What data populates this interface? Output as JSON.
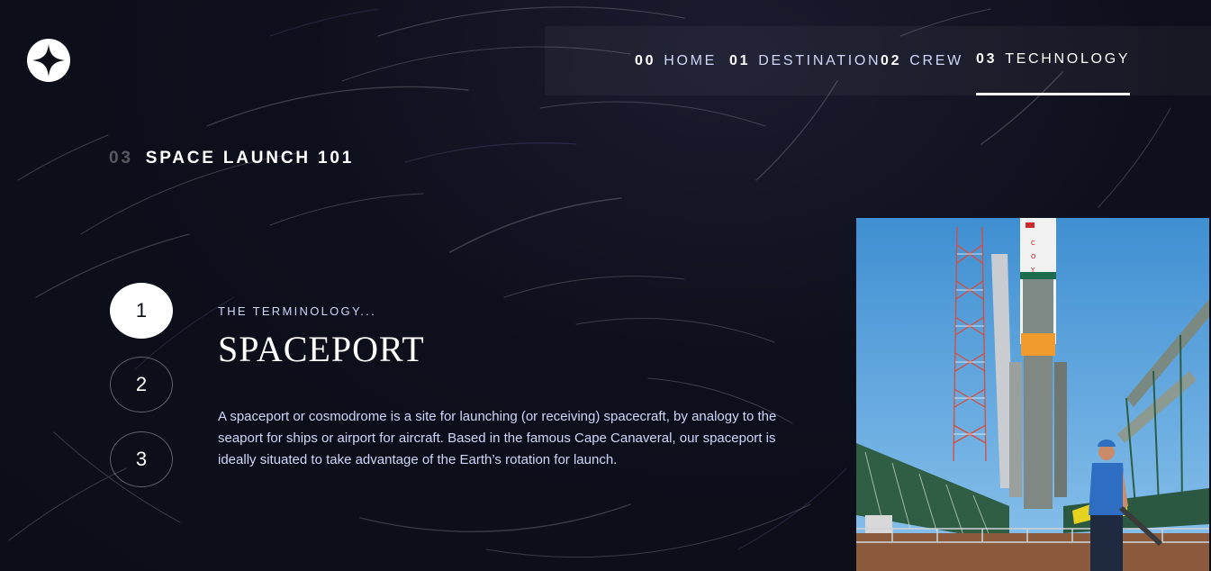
{
  "nav": {
    "items": [
      {
        "num": "00",
        "label": "HOME",
        "active": false
      },
      {
        "num": "01",
        "label": "DESTINATION",
        "active": false
      },
      {
        "num": "02",
        "label": "CREW",
        "active": false
      },
      {
        "num": "03",
        "label": "TECHNOLOGY",
        "active": true
      }
    ]
  },
  "page": {
    "eyebrow_num": "03",
    "eyebrow_text": "SPACE LAUNCH 101"
  },
  "steps": [
    {
      "label": "1",
      "active": true
    },
    {
      "label": "2",
      "active": false
    },
    {
      "label": "3",
      "active": false
    }
  ],
  "content": {
    "term_label": "THE TERMINOLOGY...",
    "term_title": "SPACEPORT",
    "term_description": "A spaceport or cosmodrome is a site for launching (or receiving) spacecraft, by analogy to the seaport for ships or airport for aircraft. Based in the famous Cape Canaveral, our spaceport is ideally situated to take advantage of the Earth’s rotation for launch."
  },
  "icons": {
    "logo": "four-point-star-icon"
  },
  "colors": {
    "background": "#0b0d17",
    "accent_text": "#d0d6f9",
    "white": "#ffffff"
  }
}
